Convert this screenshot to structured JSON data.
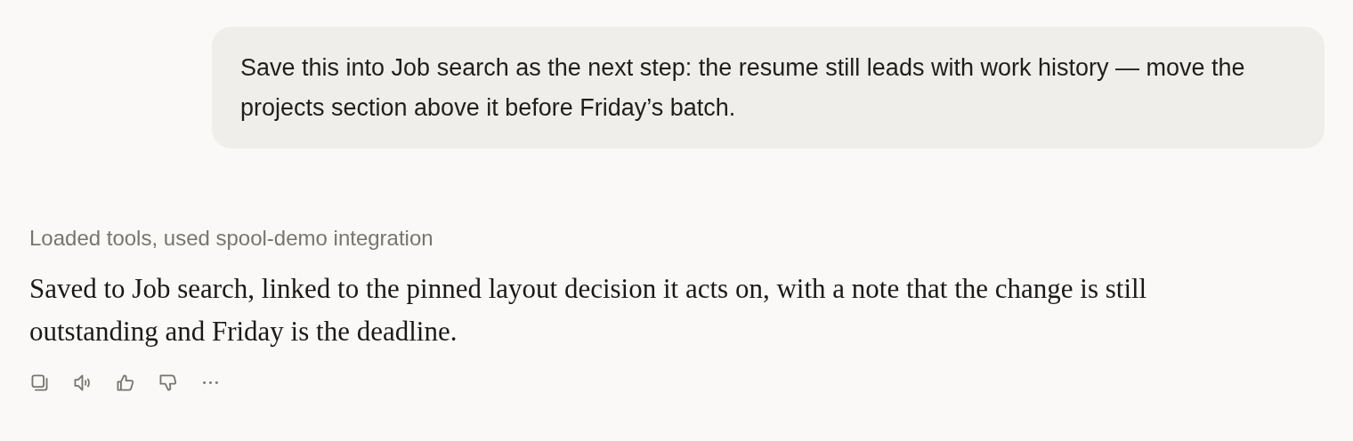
{
  "user_message": {
    "text": "Save this into Job search as the next step: the resume still leads with work history — move the projects section above it before Friday’s batch."
  },
  "assistant_message": {
    "tool_summary": "Loaded tools, used spool-demo integration",
    "text": "Saved to Job search, linked to the pinned layout decision it acts on, with a note that the change is still outstanding and Friday is the deadline."
  }
}
